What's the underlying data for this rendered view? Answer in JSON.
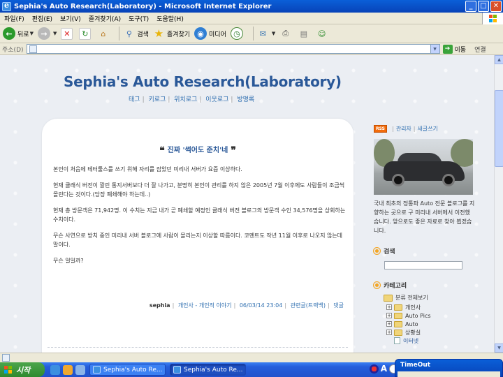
{
  "window": {
    "title": "Sephia's Auto Research(Laboratory) - Microsoft Internet Explorer",
    "minimize": "_",
    "maximize": "□",
    "close": "✕"
  },
  "menubar": [
    "파일(F)",
    "편집(E)",
    "보기(V)",
    "즐겨찾기(A)",
    "도구(T)",
    "도움말(H)"
  ],
  "toolbar": {
    "back": "뒤로",
    "search": "검색",
    "favorites": "즐겨찾기",
    "media": "미디어"
  },
  "addressbar": {
    "label": "주소(D)",
    "value": "",
    "go": "이동",
    "links": "연결"
  },
  "blog": {
    "title": "Sephia's Auto Research(Laboratory)",
    "nav": [
      "태그",
      "키로그",
      "위치로그",
      "이웃로그",
      "방명록"
    ]
  },
  "post": {
    "title": "진짜 '썩어도 준치'네",
    "open_quote": "❝",
    "close_quote": "❞",
    "paragraphs": [
      "본인이 처음에 테터툴스를 쓰기 위해 자리를 잡았던 미리내 서버가 요즘 이상하다.",
      "현재 클래식 버전이 깔린 통지서버보다 더 잘 나가고, 분명히 본인이 관리를 하지 않은 2005년 7월 이후에도 사람들이 조금씩 몰린다는 것이다.(당장 폐쇄해야 하는데..)",
      "현재 총 방문객은 71,942명. 이 수치는 지금 내가 곧 폐쇄할 예정인 클래식 버전 블로그의 방문객 수인 34,576명을 상회하는 수치이다.",
      "무슨 사연으로 방치 중인 미리내 서버 블로그에 사람이 몰리는지 이상할 따름이다. 코멘트도 작년 11월 이후로 나오지 않는데 말이다.",
      "무슨 일일까?"
    ],
    "meta": {
      "author": "sephia",
      "category": "개인사 - 개인적 이야기",
      "datetime": "06/03/14 23:04",
      "trackback": "관련글(트랙백)",
      "comments": "댓글"
    }
  },
  "sidebar": {
    "rss": "RSS",
    "admin": "관리자",
    "new_post": "새글쓰기",
    "description": "국내 최초의 정통파 Auto 전문 블로그를 지향하는 곳으로 구 미리내 서버에서 이전했습니다. 앞으로도 좋은 자료로 찾아 뵙겠습니다.",
    "search_label": "검색",
    "category_label": "카테고리",
    "category_root": "분류 전체보기",
    "categories": [
      "개인사",
      "Auto Pics",
      "Auto",
      "상황실"
    ],
    "sub_category": "이터넷"
  },
  "taskbar": {
    "start": "시작",
    "tasks": [
      "Sephia's Auto Re...",
      "Sephia's Auto Re..."
    ],
    "tray_letter": "A"
  },
  "popup": {
    "title": "TimeOut"
  }
}
